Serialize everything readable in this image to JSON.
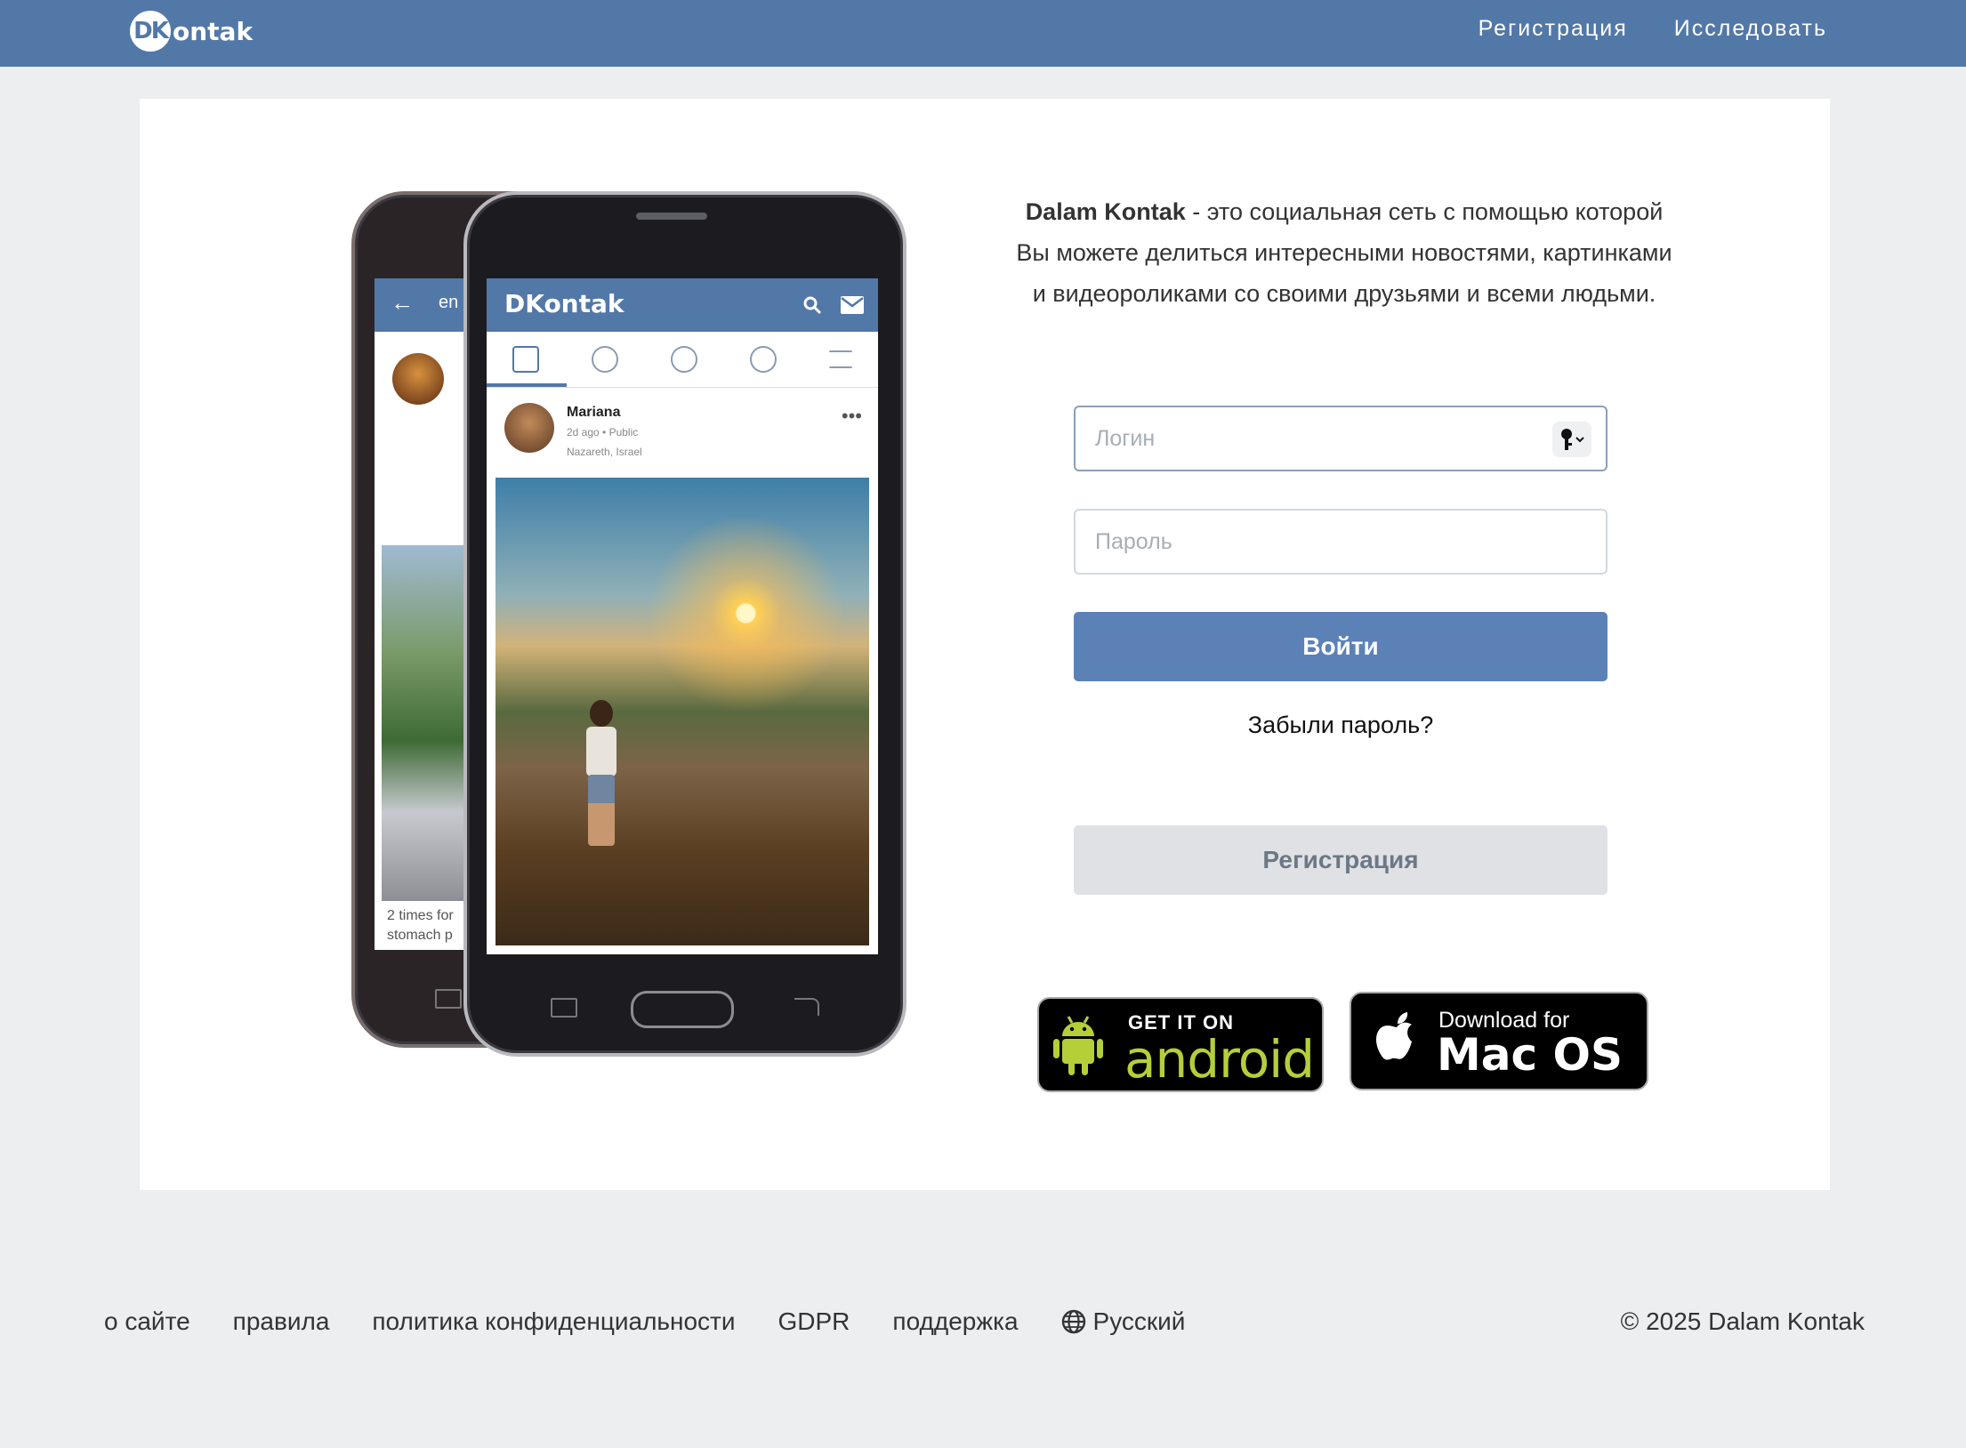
{
  "header": {
    "logo_mark": "DK",
    "logo_text": "ontak",
    "nav": [
      {
        "label": "Регистрация"
      },
      {
        "label": "Исследовать"
      }
    ]
  },
  "illustration": {
    "app_title": "DKontak",
    "back_app_title": "en",
    "post_author": "Mariana",
    "post_time": "2d ago",
    "post_visibility": "Public",
    "post_location": "Nazareth, Israel",
    "back_caption": "2 times for\nstomach p"
  },
  "intro": {
    "brand": "Dalam Kontak",
    "text": " - это социальная сеть с помощью которой Вы можете делиться интересными новостями, картинками и видеороликами со своими друзьями и всеми людьми."
  },
  "login_form": {
    "login_placeholder": "Логин",
    "login_value": "",
    "password_placeholder": "Пароль",
    "password_value": "",
    "login_button": "Войти",
    "forgot_link": "Забыли пароль?",
    "register_button": "Регистрация"
  },
  "stores": {
    "android_small": "GET IT ON",
    "android_big": "android",
    "mac_small": "Download for",
    "mac_big": "Mac OS"
  },
  "footer": {
    "links": [
      {
        "label": "о сайте"
      },
      {
        "label": "правила"
      },
      {
        "label": "политика конфиденциальности"
      },
      {
        "label": "GDPR"
      },
      {
        "label": "поддержка"
      }
    ],
    "language": "Русский",
    "copyright": "© 2025 Dalam Kontak"
  },
  "colors": {
    "header": "#5278a8",
    "primary_button": "#5b81b7",
    "secondary_button": "#dfe1e5",
    "page_background": "#edeef0"
  },
  "icons": [
    "key-icon",
    "android-robot-icon",
    "apple-icon",
    "globe-icon"
  ]
}
